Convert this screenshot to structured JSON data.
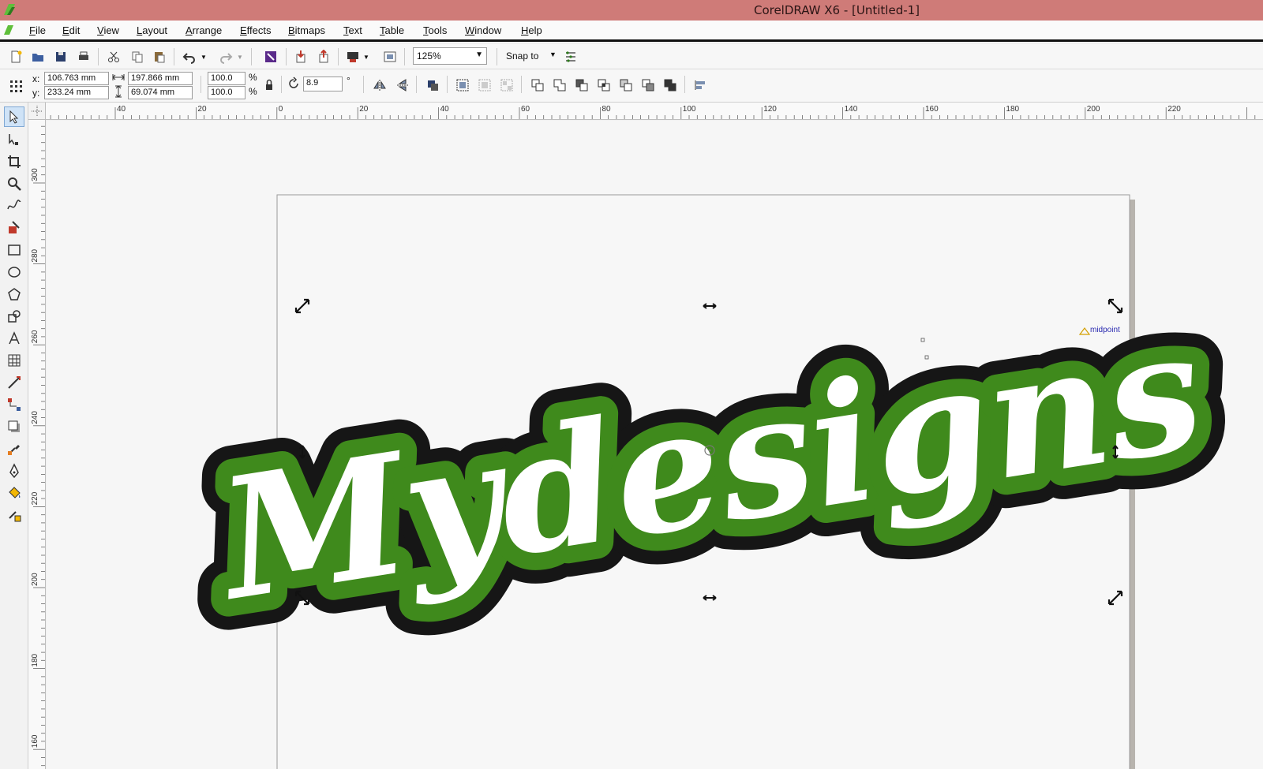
{
  "app": {
    "title": "CorelDRAW X6 - [Untitled-1]"
  },
  "menu": [
    "File",
    "Edit",
    "View",
    "Layout",
    "Arrange",
    "Effects",
    "Bitmaps",
    "Text",
    "Table",
    "Tools",
    "Window",
    "Help"
  ],
  "toolbar": {
    "zoom": "125%",
    "snap_label": "Snap to"
  },
  "property_bar": {
    "x_label": "x:",
    "y_label": "y:",
    "x_value": "106.763 mm",
    "y_value": "233.24 mm",
    "width_value": "197.866 mm",
    "height_value": "69.074 mm",
    "scale_w": "100.0",
    "scale_h": "100.0",
    "pct1": "%",
    "pct2": "%",
    "rotation": "8.9",
    "deg": "°"
  },
  "rulers": {
    "top_labels": [
      "40",
      "20",
      "0",
      "20",
      "40",
      "60",
      "80",
      "100",
      "120",
      "140",
      "160",
      "180",
      "200",
      "220"
    ],
    "left_labels": [
      "300",
      "280",
      "260",
      "240",
      "220",
      "200",
      "180",
      "160"
    ]
  },
  "artwork": {
    "text": "Mydesigns",
    "fill_color": "#ffffff",
    "inner_outline_color": "#3f8a1c",
    "outer_outline_color": "#161616",
    "snap_hint": "midpoint"
  }
}
